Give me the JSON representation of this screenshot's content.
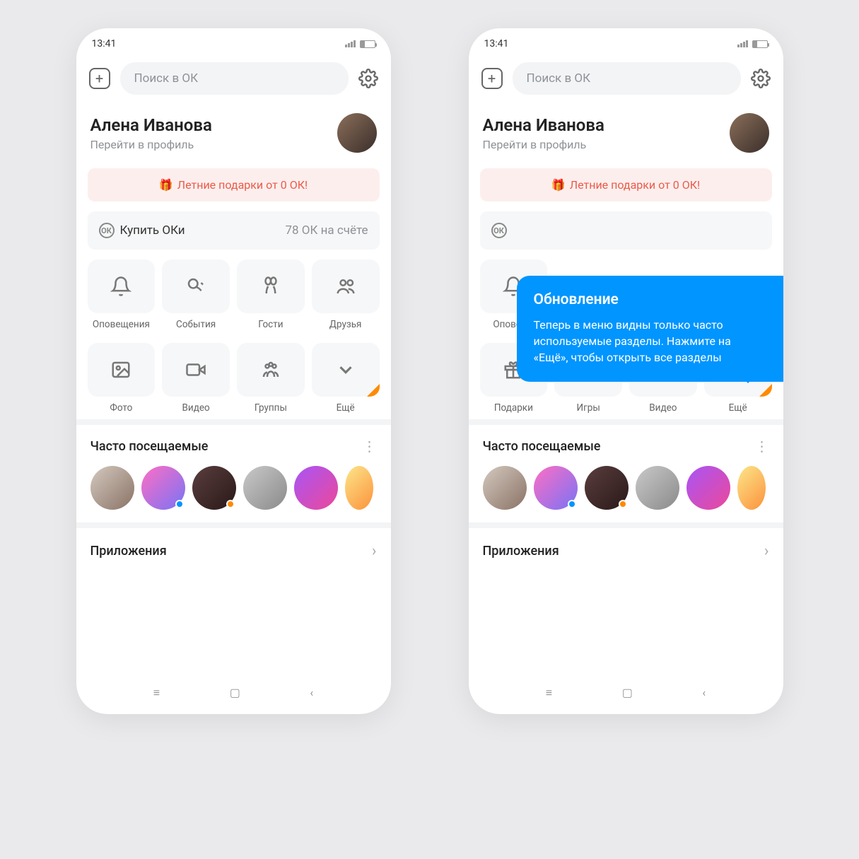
{
  "status": {
    "time": "13:41"
  },
  "search": {
    "placeholder": "Поиск в ОК"
  },
  "profile": {
    "name": "Алена Иванова",
    "sub": "Перейти в профиль"
  },
  "promo": {
    "text": "Летние подарки от 0 ОК!"
  },
  "ok": {
    "buy": "Купить ОКи",
    "balance": "78 ОК на счёте"
  },
  "gridA": [
    {
      "label": "Оповещения"
    },
    {
      "label": "События"
    },
    {
      "label": "Гости"
    },
    {
      "label": "Друзья"
    },
    {
      "label": "Фото"
    },
    {
      "label": "Видео"
    },
    {
      "label": "Группы"
    },
    {
      "label": "Ещё"
    }
  ],
  "gridB": [
    {
      "label": "Оповеще"
    },
    {
      "label": "Подарки"
    },
    {
      "label": "Игры"
    },
    {
      "label": "Видео"
    },
    {
      "label": "Ещё"
    }
  ],
  "frequent": {
    "title": "Часто посещаемые"
  },
  "apps": {
    "title": "Приложения"
  },
  "tooltip": {
    "title": "Обновление",
    "body": "Теперь в меню видны только часто используемые разделы. Нажмите на «Ещё», чтобы открыть все разделы"
  }
}
